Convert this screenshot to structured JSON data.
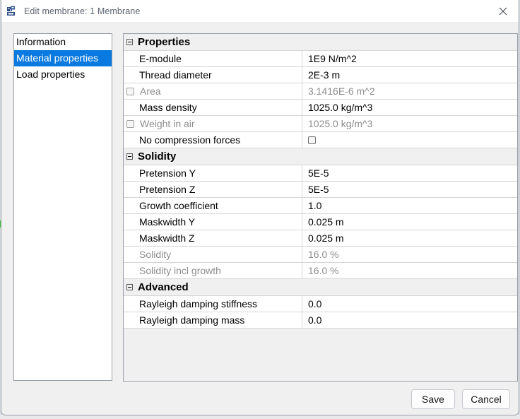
{
  "window": {
    "title": "Edit membrane: 1 Membrane",
    "icon": "membrane-app-icon",
    "close_icon": "close-icon"
  },
  "sidebar": {
    "items": [
      {
        "label": "Information",
        "selected": false
      },
      {
        "label": "Material properties",
        "selected": true
      },
      {
        "label": "Load properties",
        "selected": false
      }
    ],
    "selected_color": "#0a7ae0"
  },
  "properties": {
    "groups": [
      {
        "title": "Properties",
        "expander": "collapse-icon",
        "rows": [
          {
            "label": "E-module",
            "value": "1E9 N/m^2",
            "disabled": false,
            "label_checkbox": false,
            "value_checkbox": false
          },
          {
            "label": "Thread diameter",
            "value": "2E-3 m",
            "disabled": false,
            "label_checkbox": false,
            "value_checkbox": false
          },
          {
            "label": "Area",
            "value": "3.1416E-6 m^2",
            "disabled": true,
            "label_checkbox": true,
            "value_checkbox": false
          },
          {
            "label": "Mass density",
            "value": "1025.0 kg/m^3",
            "disabled": false,
            "label_checkbox": false,
            "value_checkbox": false
          },
          {
            "label": "Weight in air",
            "value": "1025.0 kg/m^3",
            "disabled": true,
            "label_checkbox": true,
            "value_checkbox": false
          },
          {
            "label": "No compression forces",
            "value": "",
            "disabled": false,
            "label_checkbox": false,
            "value_checkbox": true
          }
        ]
      },
      {
        "title": "Solidity",
        "expander": "collapse-icon",
        "rows": [
          {
            "label": "Pretension Y",
            "value": "5E-5",
            "disabled": false,
            "label_checkbox": false,
            "value_checkbox": false
          },
          {
            "label": "Pretension Z",
            "value": "5E-5",
            "disabled": false,
            "label_checkbox": false,
            "value_checkbox": false
          },
          {
            "label": "Growth coefficient",
            "value": "1.0",
            "disabled": false,
            "label_checkbox": false,
            "value_checkbox": false
          },
          {
            "label": "Maskwidth Y",
            "value": "0.025 m",
            "disabled": false,
            "label_checkbox": false,
            "value_checkbox": false
          },
          {
            "label": "Maskwidth Z",
            "value": "0.025 m",
            "disabled": false,
            "label_checkbox": false,
            "value_checkbox": false
          },
          {
            "label": "Solidity",
            "value": "16.0 %",
            "disabled": true,
            "label_checkbox": false,
            "value_checkbox": false
          },
          {
            "label": "Solidity incl growth",
            "value": "16.0 %",
            "disabled": true,
            "label_checkbox": false,
            "value_checkbox": false
          }
        ]
      },
      {
        "title": "Advanced",
        "expander": "collapse-icon",
        "rows": [
          {
            "label": "Rayleigh damping stiffness",
            "value": "0.0",
            "disabled": false,
            "label_checkbox": false,
            "value_checkbox": false
          },
          {
            "label": "Rayleigh damping mass",
            "value": "0.0",
            "disabled": false,
            "label_checkbox": false,
            "value_checkbox": false
          }
        ]
      }
    ]
  },
  "footer": {
    "save_label": "Save",
    "cancel_label": "Cancel"
  }
}
